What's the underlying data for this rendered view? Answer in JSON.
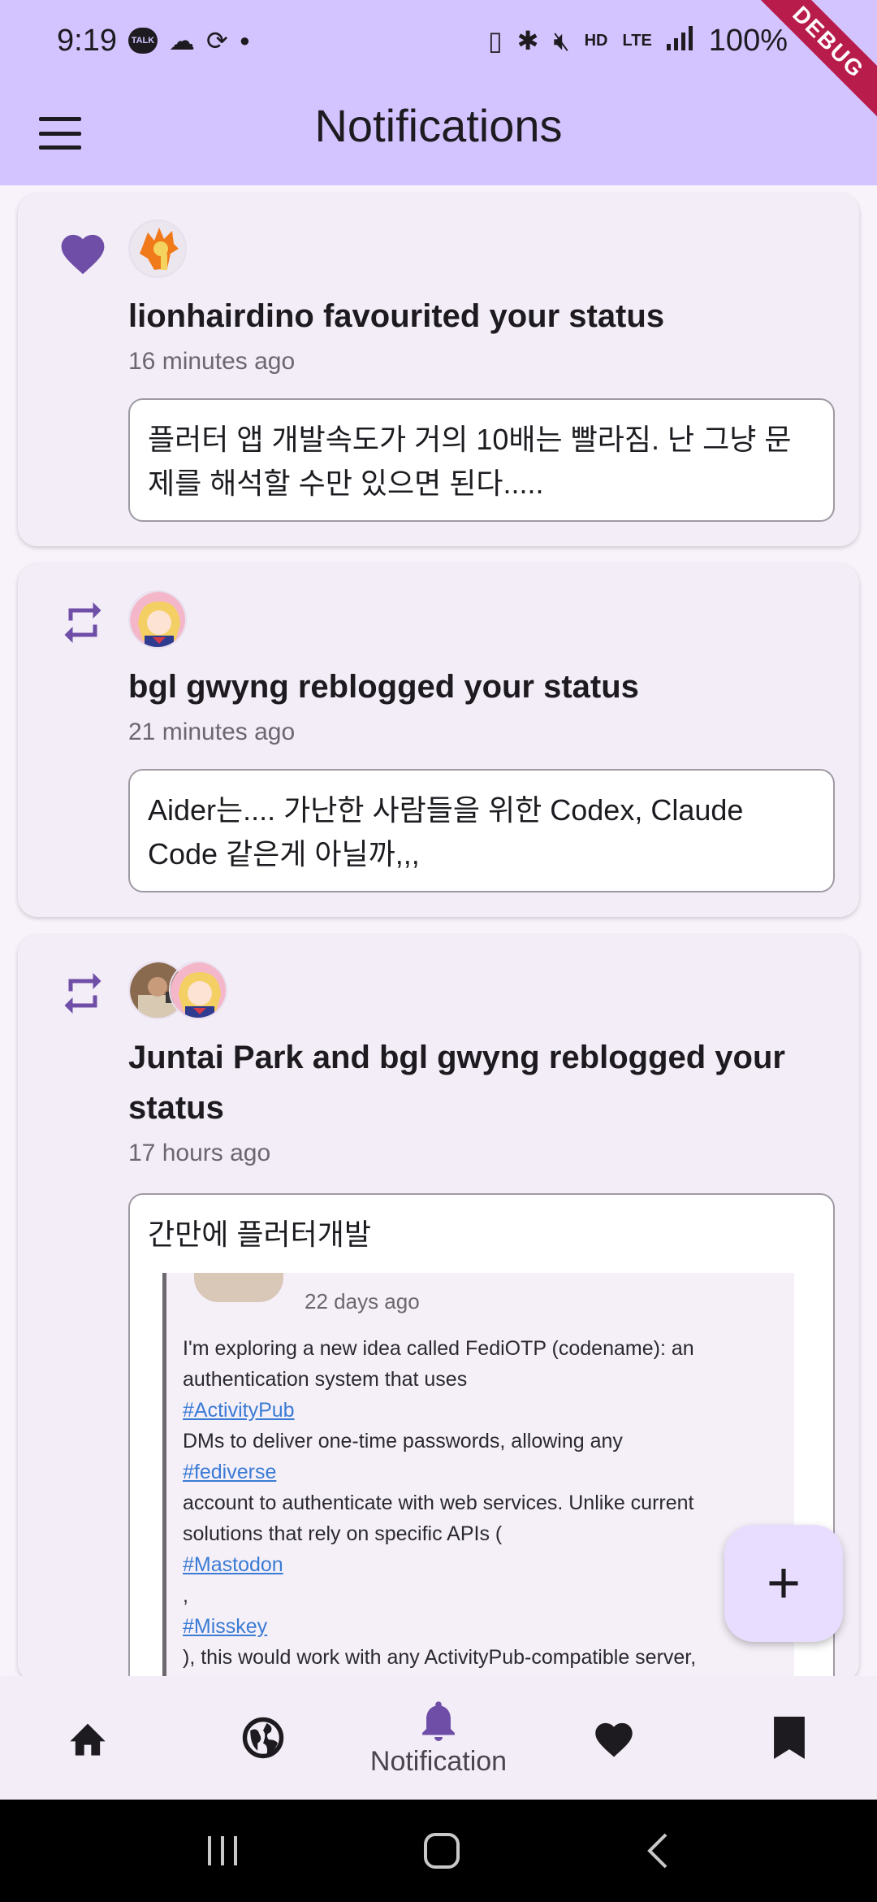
{
  "status_bar": {
    "time": "9:19",
    "talk_badge": "TALK",
    "hd_voice": "HD",
    "lte": "LTE",
    "battery": "100%",
    "debug_banner": "DEBUG"
  },
  "app_bar": {
    "title": "Notifications",
    "menu_icon": "menu-icon"
  },
  "notifications": [
    {
      "type_icon": "heart-icon",
      "title": "lionhairdino favourited your status",
      "time": "16 minutes ago",
      "status_text": "플러터 앱 개발속도가 거의 10배는 빨라짐. 난 그냥 문제를 해석할 수만 있으면 된다....."
    },
    {
      "type_icon": "repeat-icon",
      "title": "bgl gwyng reblogged your status",
      "time": "21 minutes ago",
      "status_text": "Aider는.... 가난한 사람들을 위한 Codex, Claude Code 같은게 아닐까,,,"
    },
    {
      "type_icon": "repeat-icon",
      "title": "Juntai Park and bgl gwyng reblogged your status",
      "time": "17 hours ago",
      "status_text": "간만에 플러터개발",
      "embedded": {
        "time": "22 days ago",
        "line1": "I'm exploring a new idea called FediOTP (codename): an",
        "line2": "authentication system that uses",
        "tag1": "#ActivityPub",
        "line3": "DMs to deliver one-time passwords, allowing any",
        "tag2": "#fediverse",
        "line4": "account to authenticate with web services. Unlike current",
        "line5": "solutions that rely on specific APIs (",
        "tag3": "#Mastodon",
        "line6": ",",
        "tag4": "#Misskey",
        "line7": "), this would work with any ActivityPub-compatible server,"
      }
    }
  ],
  "fab": {
    "label": "+"
  },
  "bottom_nav": {
    "items": [
      {
        "icon": "home-icon",
        "label": ""
      },
      {
        "icon": "globe-icon",
        "label": ""
      },
      {
        "icon": "bell-icon",
        "label": "Notification",
        "selected": true
      },
      {
        "icon": "heart-icon",
        "label": ""
      },
      {
        "icon": "bookmark-icon",
        "label": ""
      }
    ]
  },
  "colors": {
    "app_bar": "#d3c3ff",
    "accent": "#6f4ea8",
    "card": "#f3edf7",
    "fab": "#e8ddff"
  }
}
